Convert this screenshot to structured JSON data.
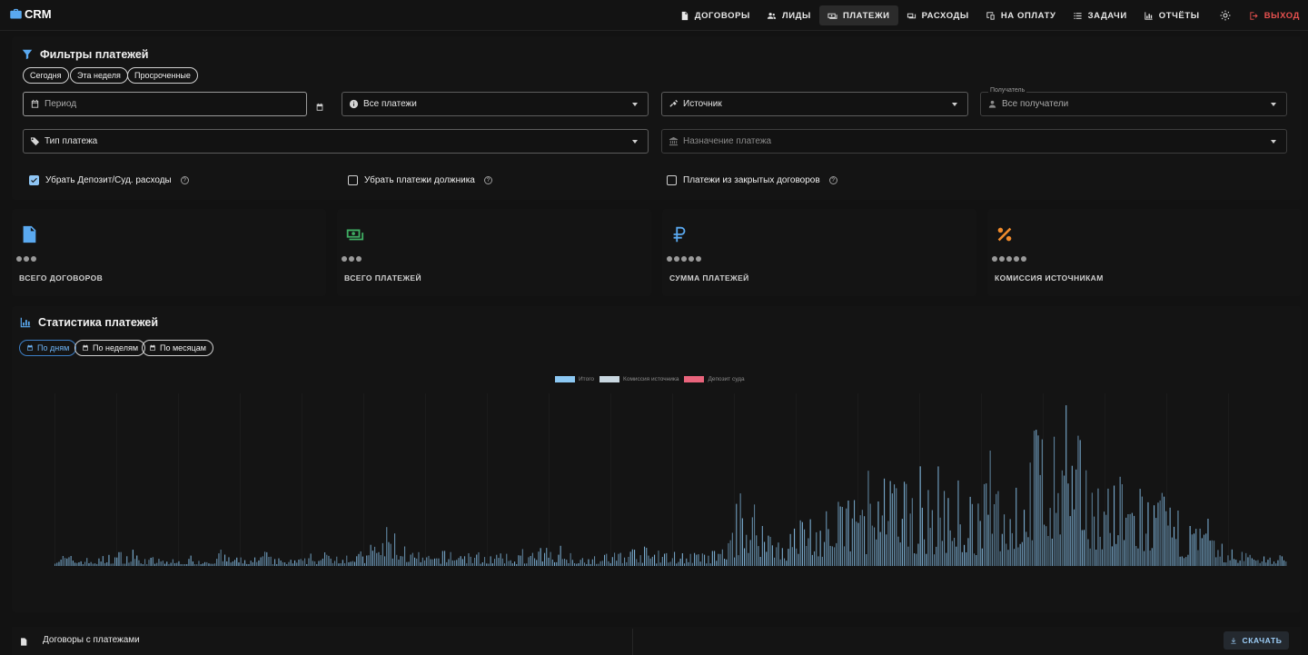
{
  "app": {
    "logo_text": "CRM"
  },
  "nav": {
    "items": [
      {
        "label": "ДОГОВОРЫ",
        "icon": "document-icon",
        "active": false
      },
      {
        "label": "ЛИДЫ",
        "icon": "people-icon",
        "active": false
      },
      {
        "label": "ПЛАТЕЖИ",
        "icon": "payments-icon",
        "active": true
      },
      {
        "label": "РАСХОДЫ",
        "icon": "expenses-icon",
        "active": false
      },
      {
        "label": "НА ОПЛАТУ",
        "icon": "to-pay-icon",
        "active": false
      },
      {
        "label": "ЗАДАЧИ",
        "icon": "tasks-icon",
        "active": false
      },
      {
        "label": "ОТЧЁТЫ",
        "icon": "reports-icon",
        "active": false
      }
    ],
    "logout_label": "ВЫХОД"
  },
  "filters": {
    "title": "Фильтры платежей",
    "quick": [
      "Сегодня",
      "Эта неделя",
      "Просроченные"
    ],
    "period_placeholder": "Период",
    "payment_status": "Все платежи",
    "source_placeholder": "Источник",
    "recipient_label": "Получатель",
    "recipient_value": "Все получатели",
    "payment_type_placeholder": "Тип платежа",
    "purpose_placeholder": "Назначение платежа",
    "checkbox_deposit": {
      "label": "Убрать Депозит/Суд. расходы",
      "checked": true
    },
    "checkbox_debtor": {
      "label": "Убрать платежи должника",
      "checked": false
    },
    "checkbox_closed": {
      "label": "Платежи из закрытых договоров",
      "checked": false
    }
  },
  "stats": [
    {
      "label": "ВСЕГО ДОГОВОРОВ",
      "icon": "document-icon",
      "color": "#5aa9f0",
      "dots": 3
    },
    {
      "label": "ВСЕГО ПЛАТЕЖЕЙ",
      "icon": "money-icon",
      "color": "#3fae63",
      "dots": 3
    },
    {
      "label": "СУММА ПЛАТЕЖЕЙ",
      "icon": "ruble-icon",
      "color": "#5aa9f0",
      "dots": 5
    },
    {
      "label": "КОМИССИЯ ИСТОЧНИКАМ",
      "icon": "percent-icon",
      "color": "#f08b2c",
      "dots": 5
    }
  ],
  "chart_section": {
    "title": "Статистика платежей",
    "grouping": [
      {
        "label": "По дням",
        "active": true
      },
      {
        "label": "По неделям",
        "active": false
      },
      {
        "label": "По месяцам",
        "active": false
      }
    ]
  },
  "chart_data": {
    "type": "bar",
    "series": [
      {
        "name": "Итого",
        "color": "#8cc8f3"
      },
      {
        "name": "Комиссия источника",
        "color": "#c9d7e0"
      },
      {
        "name": "Депозит суда",
        "color": "#e9647c"
      }
    ],
    "peaks": [
      0.09,
      0.06,
      0.05,
      0.1,
      0.07,
      0.05,
      0.04,
      0.06,
      0.08,
      0.05,
      0.07,
      0.04,
      0.05,
      0.09,
      0.11,
      0.08,
      0.28,
      0.1,
      0.06,
      0.12,
      0.09,
      0.08,
      0.07,
      0.1,
      0.15,
      0.08,
      0.06,
      0.11,
      0.13,
      0.09,
      0.1,
      0.08,
      0.12,
      0.55,
      0.3,
      0.2,
      0.4,
      0.25,
      0.55,
      0.45,
      0.6,
      0.5,
      0.45,
      0.56,
      0.42,
      0.6,
      0.52,
      1.0,
      0.75,
      0.81,
      0.6,
      0.55,
      0.52,
      0.45,
      0.32,
      0.25,
      0.12,
      0.1,
      0.08,
      0.07
    ]
  },
  "table": {
    "title": "Договоры с платежами",
    "download_label": "СКАЧАТЬ"
  }
}
